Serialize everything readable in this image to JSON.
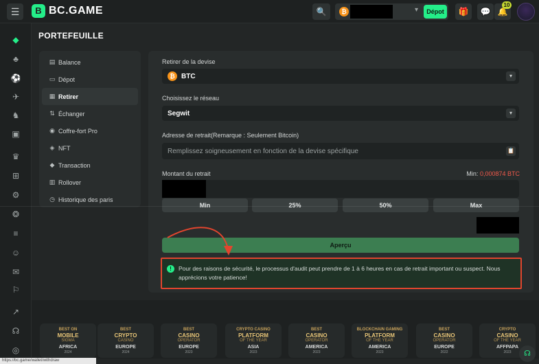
{
  "brand": {
    "logo_mark": "B",
    "name": "BC.GAME"
  },
  "header": {
    "menu_icon": "☰",
    "search_icon": "🔍",
    "coin_symbol": "₿",
    "deposit_label": "Dépot",
    "caret": "▾",
    "gift_icon": "🎁",
    "chat_icon": "💬",
    "bell_icon": "🔔",
    "notification_count": "10"
  },
  "rail": [
    {
      "icon": "◆",
      "name": "casino-icon"
    },
    {
      "icon": "♣",
      "name": "cards-icon"
    },
    {
      "icon": "⚽",
      "name": "sports-icon"
    },
    {
      "icon": "✈",
      "name": "racing-icon"
    },
    {
      "icon": "♞",
      "name": "bingo-icon"
    },
    {
      "icon": "▣",
      "name": "promo-icon"
    },
    {
      "icon": "♛",
      "name": "vip-icon"
    },
    {
      "icon": "⊞",
      "name": "gift-icon"
    },
    {
      "icon": "⚙",
      "name": "wheel-icon"
    },
    {
      "icon": "❂",
      "name": "sponsor-icon"
    },
    {
      "icon": "≡",
      "name": "stats-icon"
    },
    {
      "icon": "☺",
      "name": "community-icon"
    },
    {
      "icon": "✉",
      "name": "chat-icon"
    },
    {
      "icon": "⚐",
      "name": "language-icon"
    },
    {
      "icon": "↗",
      "name": "share-icon"
    },
    {
      "icon": "☊",
      "name": "support-icon"
    },
    {
      "icon": "◎",
      "name": "globe-icon"
    }
  ],
  "page_title": "PORTEFEUILLE",
  "nav": [
    {
      "icon": "▤",
      "label": "Balance",
      "active": false
    },
    {
      "icon": "▭",
      "label": "Dépot",
      "active": false
    },
    {
      "icon": "▦",
      "label": "Retirer",
      "active": true
    },
    {
      "icon": "⇅",
      "label": "Échanger",
      "active": false
    },
    {
      "icon": "◉",
      "label": "Coffre-fort Pro",
      "active": false
    },
    {
      "icon": "◈",
      "label": "NFT",
      "active": false
    },
    {
      "icon": "◆",
      "label": "Transaction",
      "active": false
    },
    {
      "icon": "▥",
      "label": "Rollover",
      "active": false
    },
    {
      "icon": "◷",
      "label": "Historique des paris",
      "active": false
    }
  ],
  "withdraw": {
    "currency_label": "Retirer de la devise",
    "currency_value": "BTC",
    "network_label": "Choisissez le réseau",
    "network_value": "Segwit",
    "address_label": "Adresse de retrait(Remarque : Seulement Bitcoin)",
    "address_placeholder": "Remplissez soigneusement en fonction de la devise spécifique",
    "amount_label": "Montant du retrait",
    "min_label": "Min:",
    "min_value": "0,000874 BTC",
    "quick_amounts": [
      "Min",
      "25%",
      "50%",
      "Max"
    ],
    "preview_label": "Aperçu",
    "notice": "Pour des raisons de sécurité, le processus d'audit peut prendre de 1 à 6 heures en cas de retrait important ou suspect. Nous apprécions votre patience!",
    "notice_icon": "!",
    "paste_icon": "📋"
  },
  "awards": [
    {
      "top": "BEST ON",
      "main": "MOBILE",
      "sub": "SIGMA",
      "loc": "AFRICA",
      "year": "2024"
    },
    {
      "top": "BEST",
      "main": "CRYPTO",
      "sub": "CASINO",
      "loc": "EUROPE",
      "year": "2024"
    },
    {
      "top": "BEST",
      "main": "CASINO",
      "sub": "OPERATOR",
      "loc": "EUROPE",
      "year": "2023"
    },
    {
      "top": "CRYPTO CASINO",
      "main": "PLATFORM",
      "sub": "OF THE YEAR",
      "loc": "ASIA",
      "year": "2023"
    },
    {
      "top": "BEST",
      "main": "CASINO",
      "sub": "OPERATOR",
      "loc": "AMERICA",
      "year": "2023"
    },
    {
      "top": "BLOCKCHAIN GAMING",
      "main": "PLATFORM",
      "sub": "OF THE YEAR",
      "loc": "AMERICA",
      "year": "2023"
    },
    {
      "top": "BEST",
      "main": "CASINO",
      "sub": "OPERATOR",
      "loc": "EUROPE",
      "year": "2022"
    },
    {
      "top": "CRYPTO",
      "main": "CASINO",
      "sub": "OF THE YEAR",
      "loc": "AFFPAPA",
      "year": "2023"
    }
  ],
  "status_url": "https://bc.game/wallet/withdraw",
  "colors": {
    "accent": "#24ee89",
    "alert_border": "#e2452e",
    "min_value": "#f2594b",
    "btc": "#f7931a"
  }
}
